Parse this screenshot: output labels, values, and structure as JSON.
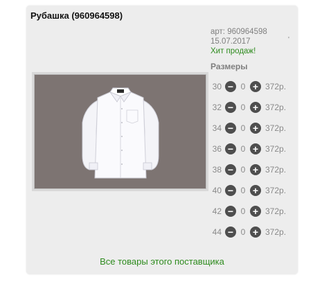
{
  "product": {
    "title": "Рубашка (960964598)",
    "article": "арт: 960964598",
    "date": "15.07.2017",
    "hit": "Хит продаж!",
    "tick": "'"
  },
  "sizes": {
    "title": "Размеры",
    "items": [
      {
        "size": "30",
        "qty": "0",
        "price": "372р."
      },
      {
        "size": "32",
        "qty": "0",
        "price": "372р."
      },
      {
        "size": "34",
        "qty": "0",
        "price": "372р."
      },
      {
        "size": "36",
        "qty": "0",
        "price": "372р."
      },
      {
        "size": "38",
        "qty": "0",
        "price": "372р."
      },
      {
        "size": "40",
        "qty": "0",
        "price": "372р."
      },
      {
        "size": "42",
        "qty": "0",
        "price": "372р."
      },
      {
        "size": "44",
        "qty": "0",
        "price": "372р."
      }
    ]
  },
  "footer": {
    "supplier_link": "Все товары этого поставщика"
  },
  "colors": {
    "accent_green": "#2e8b1e",
    "card_bg": "#ededed",
    "photo_bg": "#7d7472",
    "button": "#4e4e4e"
  },
  "icons": [
    "minus-icon",
    "plus-icon"
  ]
}
